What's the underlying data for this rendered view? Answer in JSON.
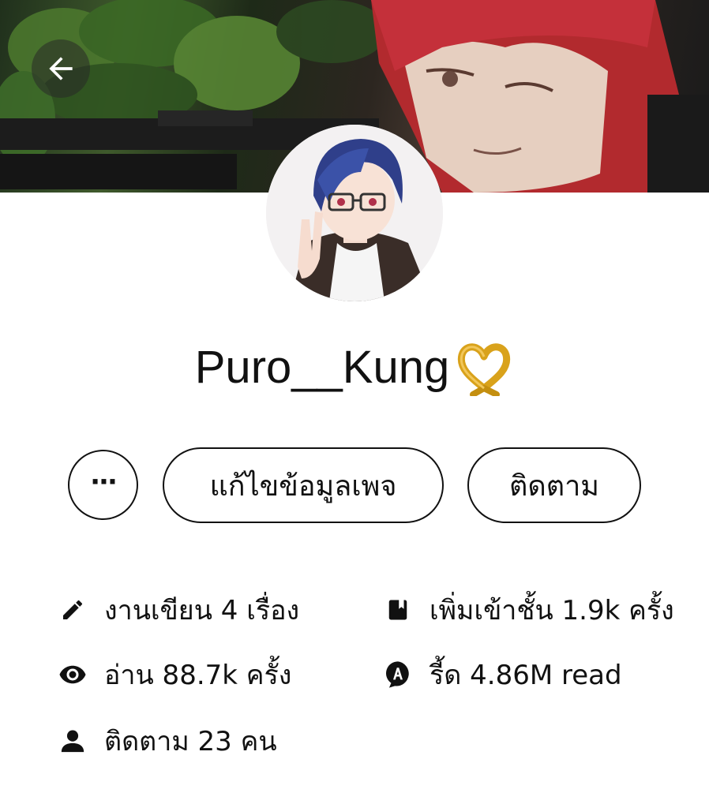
{
  "header": {
    "back_icon": "arrow-left-icon"
  },
  "profile": {
    "username": "Puro__Kung",
    "badge_icon": "gold-heart-ribbon-icon"
  },
  "actions": {
    "more_label": "···",
    "edit_label": "แก้ไขข้อมูลเพจ",
    "follow_label": "ติดตาม"
  },
  "stats": {
    "works": {
      "icon": "pencil-icon",
      "text": "งานเขียน 4 เรื่อง"
    },
    "shelf": {
      "icon": "bookmark-book-icon",
      "text": "เพิ่มเข้าชั้น 1.9k ครั้ง"
    },
    "reads": {
      "icon": "eye-icon",
      "text": "อ่าน 88.7k ครั้ง"
    },
    "reed": {
      "icon": "reed-badge-icon",
      "text": "รี้ด 4.86M read"
    },
    "followers": {
      "icon": "person-icon",
      "text": "ติดตาม 23 คน"
    }
  },
  "colors": {
    "text": "#111111",
    "background": "#ffffff",
    "heart_gold": "#d9a21b"
  }
}
